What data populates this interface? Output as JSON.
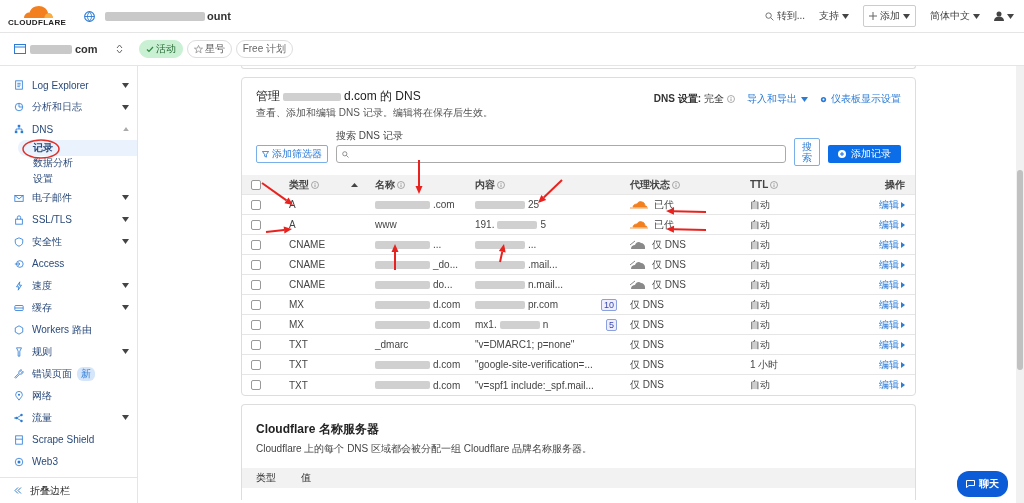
{
  "topbar": {
    "logo_text": "CLOUDFLARE",
    "account_suffix": "ount",
    "goto": "转到...",
    "support": "支持",
    "add": "添加",
    "language": "简体中文"
  },
  "zone": {
    "domain_suffix": "com",
    "badges": [
      {
        "kind": "status",
        "label": "活动"
      },
      {
        "kind": "star",
        "label": "星号"
      },
      {
        "kind": "plan",
        "label": "Free 计划"
      }
    ]
  },
  "sidebar": {
    "items": [
      {
        "label": "Log Explorer",
        "kind": "menu",
        "expanded": false
      },
      {
        "label": "分析和日志",
        "kind": "menu",
        "expanded": false
      },
      {
        "label": "DNS",
        "kind": "menu",
        "expanded": true,
        "children": [
          {
            "label": "记录",
            "selected": true
          },
          {
            "label": "数据分析",
            "selected": false
          },
          {
            "label": "设置",
            "selected": false
          }
        ]
      },
      {
        "label": "电子邮件",
        "kind": "menu",
        "expanded": false
      },
      {
        "label": "SSL/TLS",
        "kind": "menu",
        "expanded": false
      },
      {
        "label": "安全性",
        "kind": "menu",
        "expanded": false
      },
      {
        "label": "Access",
        "kind": "link",
        "expanded": false
      },
      {
        "label": "速度",
        "kind": "menu",
        "expanded": false
      },
      {
        "label": "缓存",
        "kind": "menu",
        "expanded": false
      },
      {
        "label": "Workers 路由",
        "kind": "link",
        "expanded": false
      },
      {
        "label": "规则",
        "kind": "menu",
        "expanded": false
      },
      {
        "label": "错误页面",
        "kind": "link",
        "expanded": false,
        "badge": "新"
      },
      {
        "label": "网络",
        "kind": "link",
        "expanded": false
      },
      {
        "label": "流量",
        "kind": "menu",
        "expanded": false
      },
      {
        "label": "Scrape Shield",
        "kind": "link",
        "expanded": false
      },
      {
        "label": "Web3",
        "kind": "link",
        "expanded": false
      }
    ],
    "collapse": "折叠边栏"
  },
  "dns": {
    "title_prefix": "管理",
    "title_suffix": "d.com 的 DNS",
    "description": "查看、添加和编辑 DNS 记录。编辑将在保存后生效。",
    "settings_label": "DNS 设置:",
    "settings_value": "完全",
    "import_export": "导入和导出",
    "dashboard_settings": "仪表板显示设置",
    "search_label": "搜索 DNS 记录",
    "filter_button": "添加筛选器",
    "search_button": "搜索",
    "add_button": "添加记录",
    "columns": [
      "类型",
      "名称",
      "内容",
      "代理状态",
      "TTL",
      "操作"
    ],
    "all_checked": false,
    "rows": [
      {
        "checked": false,
        "type": "A",
        "name": {
          "redacted": true,
          "suffix": ".com"
        },
        "content": {
          "redacted": true,
          "suffix": "25"
        },
        "kind": "cloud",
        "proxied": true,
        "proxy_text": "已代",
        "ttl": "自动",
        "action": "编辑"
      },
      {
        "checked": false,
        "type": "A",
        "name": {
          "redacted": false,
          "prefix": "www"
        },
        "content": {
          "redacted": true,
          "prefix": "191.",
          "suffix": "5"
        },
        "kind": "cloud",
        "proxied": true,
        "proxy_text": "已代",
        "ttl": "自动",
        "action": "编辑"
      },
      {
        "checked": false,
        "type": "CNAME",
        "name": {
          "redacted": true,
          "suffix": "..."
        },
        "content": {
          "redacted": true,
          "suffix": "..."
        },
        "kind": "cloud",
        "proxied": false,
        "proxy_text": "仅 DNS",
        "ttl": "自动",
        "action": "编辑"
      },
      {
        "checked": false,
        "type": "CNAME",
        "name": {
          "redacted": true,
          "suffix": "_do..."
        },
        "content": {
          "redacted": true,
          "suffix": ".mail..."
        },
        "kind": "cloud",
        "proxied": false,
        "proxy_text": "仅 DNS",
        "ttl": "自动",
        "action": "编辑"
      },
      {
        "checked": false,
        "type": "CNAME",
        "name": {
          "redacted": true,
          "suffix": "do..."
        },
        "content": {
          "redacted": true,
          "suffix": "n.mail..."
        },
        "kind": "cloud",
        "proxied": false,
        "proxy_text": "仅 DNS",
        "ttl": "自动",
        "action": "编辑"
      },
      {
        "checked": false,
        "type": "MX",
        "name": {
          "redacted": true,
          "suffix": "d.com"
        },
        "content": {
          "redacted": true,
          "suffix": "pr.com"
        },
        "priority": "10",
        "kind": "plain",
        "proxy_text": "仅 DNS",
        "ttl": "自动",
        "action": "编辑"
      },
      {
        "checked": false,
        "type": "MX",
        "name": {
          "redacted": true,
          "suffix": "d.com"
        },
        "content": {
          "redacted": true,
          "prefix": "mx1.",
          "suffix": "n"
        },
        "priority": "5",
        "kind": "plain",
        "proxy_text": "仅 DNS",
        "ttl": "自动",
        "action": "编辑"
      },
      {
        "checked": false,
        "type": "TXT",
        "name": {
          "redacted": false,
          "prefix": "_dmarc"
        },
        "content": {
          "redacted": false,
          "prefix": "\"v=DMARC1; p=none\""
        },
        "kind": "plain",
        "proxy_text": "仅 DNS",
        "ttl": "自动",
        "action": "编辑"
      },
      {
        "checked": false,
        "type": "TXT",
        "name": {
          "redacted": true,
          "suffix": "d.com"
        },
        "content": {
          "redacted": false,
          "prefix": "\"google-site-verification=..."
        },
        "kind": "plain",
        "proxy_text": "仅 DNS",
        "ttl": "1 小时",
        "action": "编辑"
      },
      {
        "checked": false,
        "type": "TXT",
        "name": {
          "redacted": true,
          "suffix": "d.com"
        },
        "content": {
          "redacted": false,
          "prefix": "\"v=spf1 include:_spf.mail..."
        },
        "kind": "plain",
        "proxy_text": "仅 DNS",
        "ttl": "自动",
        "action": "编辑"
      }
    ]
  },
  "nameservers": {
    "title": "Cloudflare 名称服务器",
    "description": "Cloudflare 上的每个 DNS 区域都会被分配一组 Cloudflare 品牌名称服务器。",
    "columns": [
      "类型",
      "值"
    ]
  },
  "chat": "聊天"
}
